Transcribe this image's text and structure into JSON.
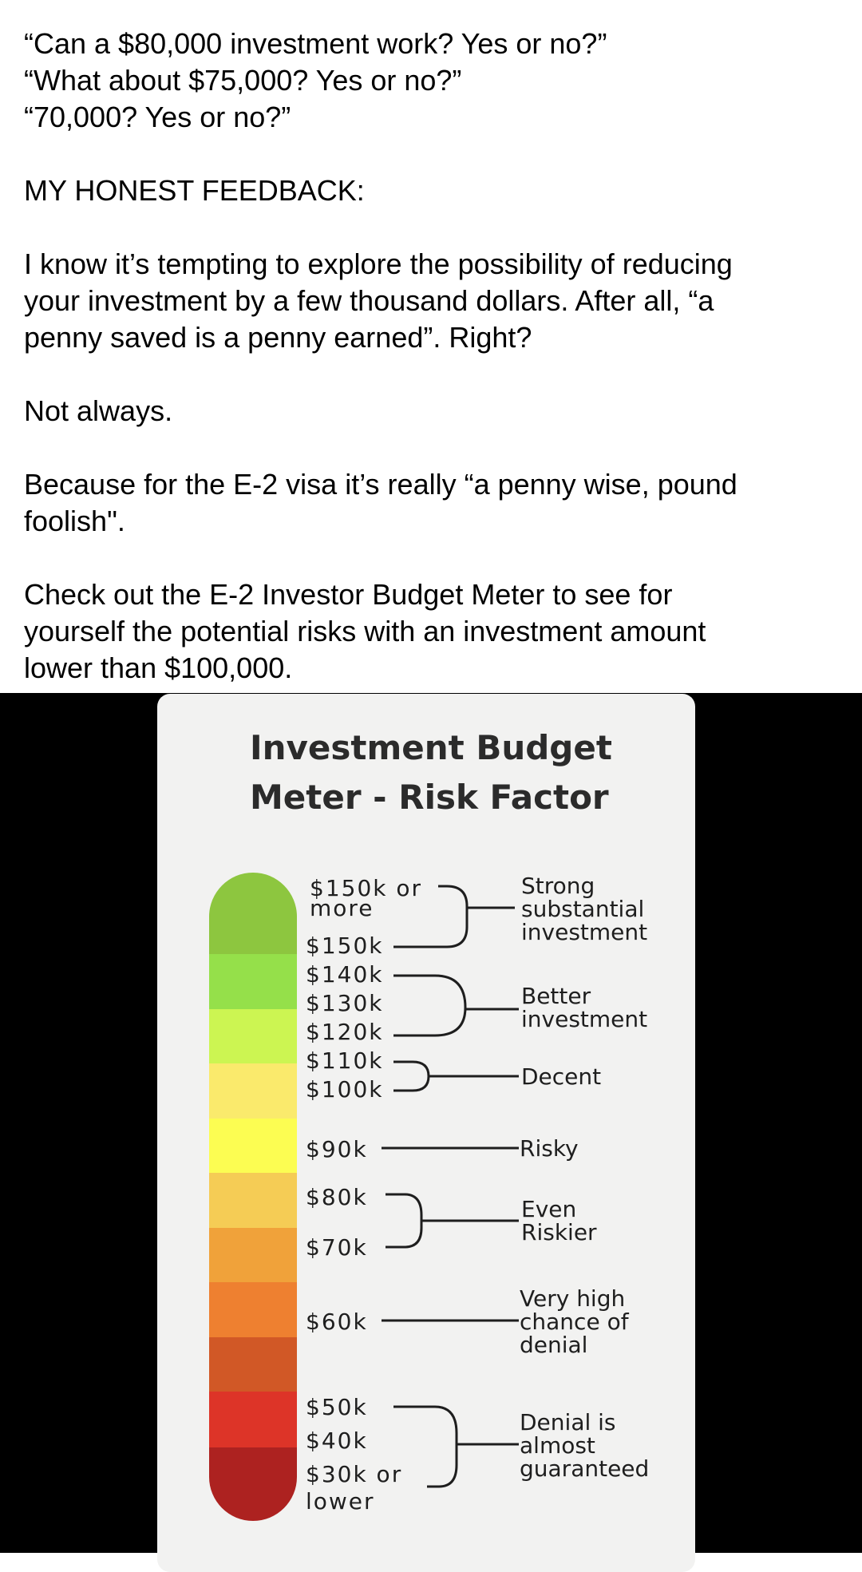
{
  "post": {
    "paragraphs": [
      "“Can a $80,000 investment work? Yes or no?”\n“What about $75,000? Yes or no?”\n“70,000? Yes or no?”",
      "MY HONEST FEEDBACK:",
      "I know it’s tempting to explore the possibility of reducing\nyour investment by a few thousand dollars. After all, “a\npenny saved is a penny earned”. Right?",
      "Not always.",
      "Because for the E-2 visa it’s really “a penny wise, pound\nfoolish\".",
      "Check out the E-2 Investor Budget Meter to see for\nyourself the potential risks with an investment amount\nlower than $100,000."
    ]
  },
  "meter": {
    "title": "Investment Budget\nMeter - Risk Factor",
    "amounts": {
      "a150_or_more_1": "$150k or",
      "a150_or_more_2": "more",
      "a150": "$150k",
      "a140": "$140k",
      "a130": "$130k",
      "a120": "$120k",
      "a110": "$110k",
      "a100": "$100k",
      "a90": "$90k",
      "a80": "$80k",
      "a70": "$70k",
      "a60": "$60k",
      "a50": "$50k",
      "a40": "$40k",
      "a30_1": "$30k or",
      "a30_2": "lower"
    },
    "risks": {
      "strong_1": "Strong",
      "strong_2": "substantial",
      "strong_3": "investment",
      "better_1": "Better",
      "better_2": "investment",
      "decent": "Decent",
      "risky": "Risky",
      "riskier_1": "Even",
      "riskier_2": "Riskier",
      "veryhigh_1": "Very high",
      "veryhigh_2": "chance of",
      "veryhigh_3": "denial",
      "denial_1": "Denial is",
      "denial_2": "almost",
      "denial_3": "guaranteed"
    },
    "colors": [
      "#8dc63f",
      "#95e04a",
      "#ccf552",
      "#faea6c",
      "#fcfd52",
      "#f5cc55",
      "#f0a23a",
      "#ee8030",
      "#d15826",
      "#dd3428",
      "#ad2220"
    ]
  }
}
